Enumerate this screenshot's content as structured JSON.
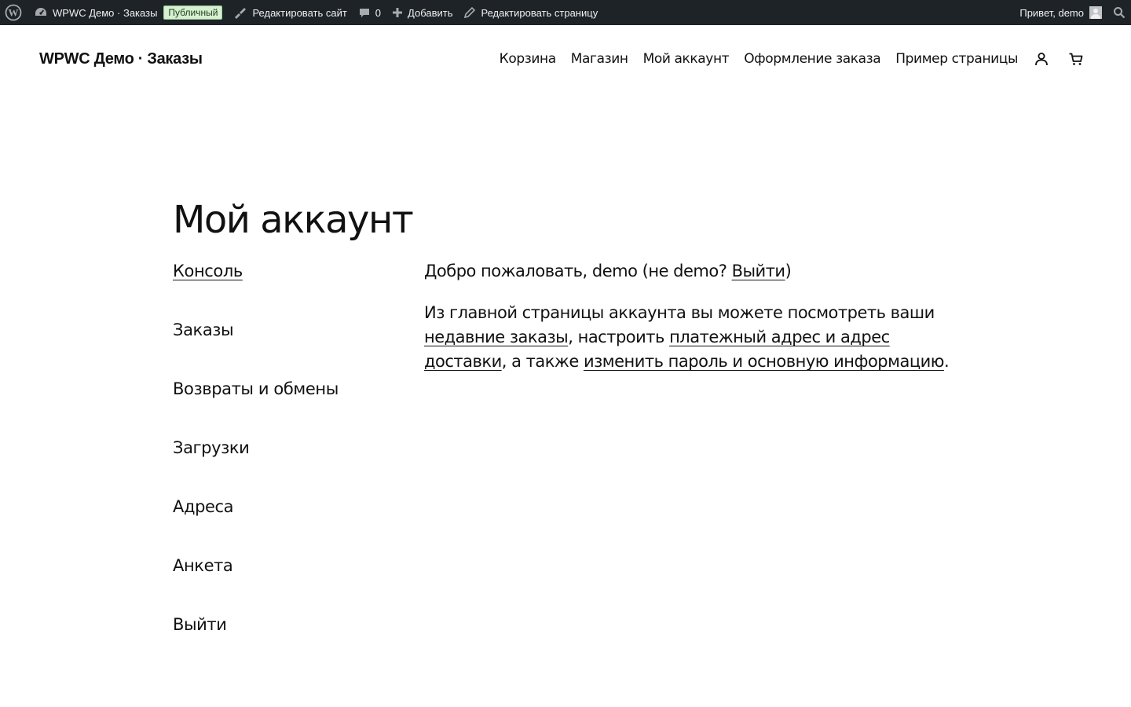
{
  "admin_bar": {
    "site_name": "WPWC Демо · Заказы",
    "visibility_badge": "Публичный",
    "edit_site": "Редактировать сайт",
    "comments_count": "0",
    "add_new": "Добавить",
    "edit_page": "Редактировать страницу",
    "greeting": "Привет, demo"
  },
  "header": {
    "site_title": "WPWC Демо · Заказы",
    "nav": [
      "Корзина",
      "Магазин",
      "Мой аккаунт",
      "Оформление заказа",
      "Пример страницы"
    ]
  },
  "page": {
    "title": "Мой аккаунт"
  },
  "account_nav": [
    "Консоль",
    "Заказы",
    "Возвраты и обмены",
    "Загрузки",
    "Адреса",
    "Анкета",
    "Выйти"
  ],
  "account_content": {
    "welcome_prefix": "Добро пожаловать, ",
    "username": "demo",
    "not_prefix": " (не ",
    "username_again": "demo",
    "question": "? ",
    "logout_link": "Выйти",
    "close_paren": ")",
    "intro_text": "Из главной страницы аккаунта вы можете посмотреть ваши ",
    "recent_orders_link": "недавние заказы",
    "middle_text": ", настроить ",
    "addresses_link": "платежный адрес и адрес доставки",
    "also_text": ", а также ",
    "account_details_link": "изменить пароль и основную информацию",
    "end_text": "."
  },
  "colors": {
    "admin_bar_bg": "#1d2327",
    "badge_bg": "#d7f0d2",
    "text": "#111111",
    "background": "#ffffff"
  }
}
